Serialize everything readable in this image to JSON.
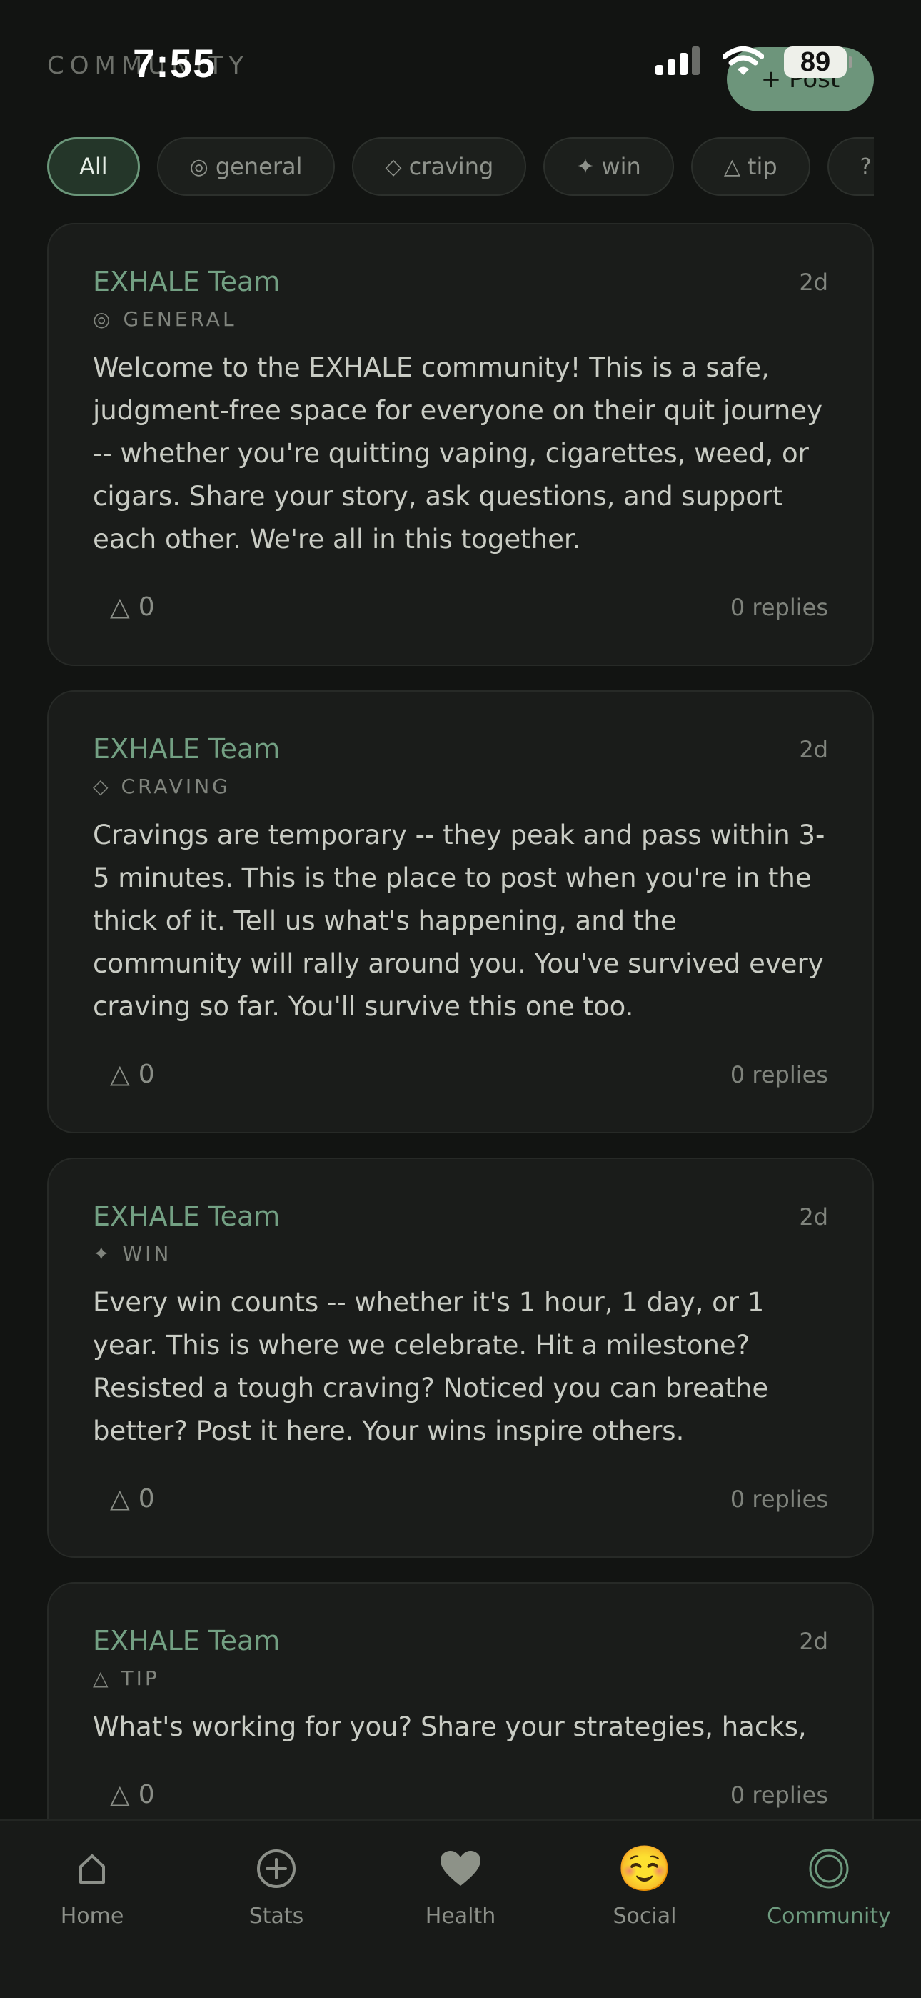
{
  "status_bar": {
    "time": "7:55",
    "battery": "89"
  },
  "header": {
    "title": "COMMUNITY",
    "post_button": "+ Post"
  },
  "filters": [
    {
      "icon": "",
      "label": "All",
      "active": true
    },
    {
      "icon": "◎",
      "label": "general"
    },
    {
      "icon": "◇",
      "label": "craving"
    },
    {
      "icon": "✦",
      "label": "win"
    },
    {
      "icon": "△",
      "label": "tip"
    },
    {
      "icon": "?",
      "label": ""
    }
  ],
  "posts": [
    {
      "author": "EXHALE Team",
      "time": "2d",
      "category_icon": "◎",
      "category": "GENERAL",
      "body": "Welcome to the EXHALE community! This is a safe, judgment-free space for everyone on their quit journey -- whether you're quitting vaping, cigarettes, weed, or cigars. Share your story, ask questions, and support each other. We're all in this together.",
      "likes_icon": "△",
      "likes": "0",
      "replies": "0 replies"
    },
    {
      "author": "EXHALE Team",
      "time": "2d",
      "category_icon": "◇",
      "category": "CRAVING",
      "body": "Cravings are temporary -- they peak and pass within 3-5 minutes. This is the place to post when you're in the thick of it. Tell us what's happening, and the community will rally around you. You've survived every craving so far. You'll survive this one too.",
      "likes_icon": "△",
      "likes": "0",
      "replies": "0 replies"
    },
    {
      "author": "EXHALE Team",
      "time": "2d",
      "category_icon": "✦",
      "category": "WIN",
      "body": "Every win counts -- whether it's 1 hour, 1 day, or 1 year. This is where we celebrate. Hit a milestone? Resisted a tough craving? Noticed you can breathe better? Post it here. Your wins inspire others.",
      "likes_icon": "△",
      "likes": "0",
      "replies": "0 replies"
    },
    {
      "author": "EXHALE Team",
      "time": "2d",
      "category_icon": "△",
      "category": "TIP",
      "body": "What's working for you? Share your strategies, hacks,",
      "likes_icon": "△",
      "likes": "0",
      "replies": "0 replies"
    }
  ],
  "tabbar": [
    {
      "label": "Home",
      "icon": "home-icon"
    },
    {
      "label": "Stats",
      "icon": "plus-circle-icon"
    },
    {
      "label": "Health",
      "icon": "heart-icon"
    },
    {
      "label": "Social",
      "icon": "smiling-face-emoji-icon",
      "emoji": "☺️"
    },
    {
      "label": "Community",
      "icon": "ring-icon",
      "active": true
    }
  ],
  "colors": {
    "background": "#121412",
    "card": "#1a1c1a",
    "accent": "#6e9b7f",
    "post_button": "#6d957b"
  }
}
